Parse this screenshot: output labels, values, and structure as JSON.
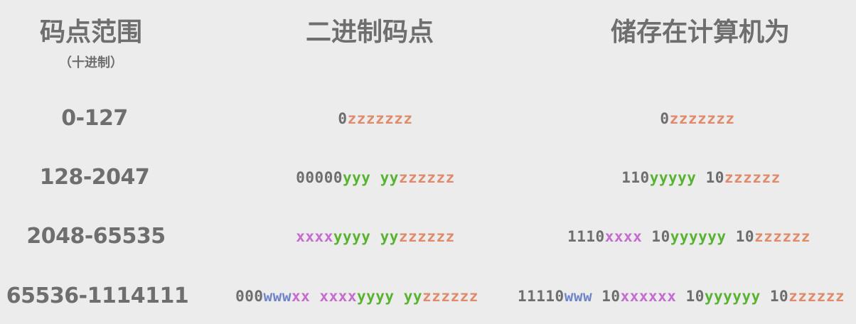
{
  "headers": {
    "range": "码点范围",
    "range_sub": "（十进制）",
    "binary": "二进制码点",
    "stored": "储存在计算机为"
  },
  "colors": {
    "gray": "#6e6e6e",
    "orange": "#e08a6a",
    "green": "#58b331",
    "purple": "#c56ccf",
    "blue": "#6e84c8"
  },
  "rows": [
    {
      "range": "0-127",
      "binary": [
        {
          "text": "0",
          "color": "gray"
        },
        {
          "text": "zzzzzzz",
          "color": "orange"
        }
      ],
      "stored": [
        {
          "text": "0",
          "color": "gray"
        },
        {
          "text": "zzzzzzz",
          "color": "orange"
        }
      ]
    },
    {
      "range": "128-2047",
      "binary": [
        {
          "text": "00000",
          "color": "gray"
        },
        {
          "text": "yyy",
          "color": "green"
        },
        {
          "text": " ",
          "color": "gray"
        },
        {
          "text": "yy",
          "color": "green"
        },
        {
          "text": "zzzzzz",
          "color": "orange"
        }
      ],
      "stored": [
        {
          "text": "110",
          "color": "gray"
        },
        {
          "text": "yyyyy",
          "color": "green"
        },
        {
          "text": " 10",
          "color": "gray"
        },
        {
          "text": "zzzzzz",
          "color": "orange"
        }
      ]
    },
    {
      "range": "2048-65535",
      "binary": [
        {
          "text": "xxxx",
          "color": "purple"
        },
        {
          "text": "yyyy",
          "color": "green"
        },
        {
          "text": " ",
          "color": "gray"
        },
        {
          "text": "yy",
          "color": "green"
        },
        {
          "text": "zzzzzz",
          "color": "orange"
        }
      ],
      "stored": [
        {
          "text": "1110",
          "color": "gray"
        },
        {
          "text": "xxxx",
          "color": "purple"
        },
        {
          "text": " 10",
          "color": "gray"
        },
        {
          "text": "yyyyyy",
          "color": "green"
        },
        {
          "text": " 10",
          "color": "gray"
        },
        {
          "text": "zzzzzz",
          "color": "orange"
        }
      ]
    },
    {
      "range": "65536-1114111",
      "binary": [
        {
          "text": "000",
          "color": "gray"
        },
        {
          "text": "www",
          "color": "blue"
        },
        {
          "text": "xx",
          "color": "purple"
        },
        {
          "text": " ",
          "color": "gray"
        },
        {
          "text": "xxxx",
          "color": "purple"
        },
        {
          "text": "yyyy",
          "color": "green"
        },
        {
          "text": " ",
          "color": "gray"
        },
        {
          "text": "yy",
          "color": "green"
        },
        {
          "text": "zzzzzz",
          "color": "orange"
        }
      ],
      "stored": [
        {
          "text": "11110",
          "color": "gray"
        },
        {
          "text": "www",
          "color": "blue"
        },
        {
          "text": " 10",
          "color": "gray"
        },
        {
          "text": "xxxxxx",
          "color": "purple"
        },
        {
          "text": " 10",
          "color": "gray"
        },
        {
          "text": "yyyyyy",
          "color": "green"
        },
        {
          "text": " 10",
          "color": "gray"
        },
        {
          "text": "zzzzzz",
          "color": "orange"
        }
      ]
    }
  ]
}
